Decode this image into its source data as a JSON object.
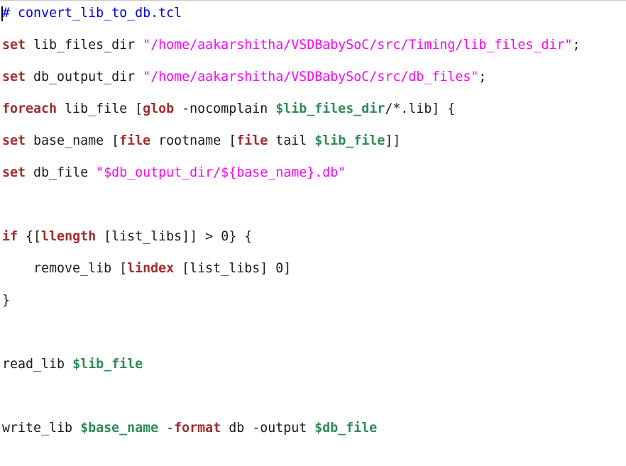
{
  "editor": {
    "colors": {
      "keyword": "#a52a2a",
      "variable": "#2e8b57",
      "string": "#ff00ff",
      "comment": "#0000ee",
      "text": "#1a1a1a",
      "background": "#ffffff"
    },
    "lines": {
      "l1": {
        "comment": "# convert_lib_to_db.tcl"
      },
      "l2": {
        "kw": "set",
        "text": " lib_files_dir ",
        "str": "\"/home/aakarshitha/VSDBabySoC/src/Timing/lib_files_dir\"",
        "tail": ";"
      },
      "l3": {
        "kw": "set",
        "text": " db_output_dir ",
        "str": "\"/home/aakarshitha/VSDBabySoC/src/db_files\"",
        "tail": ";"
      },
      "l4": {
        "kw": "foreach",
        "t1": " lib_file [",
        "kw2": "glob",
        "t2": " -nocomplain ",
        "var": "$lib_files_dir",
        "t3": "/*.lib] {"
      },
      "l5": {
        "kw": "set",
        "t1": " base_name [",
        "kw2": "file",
        "t2": " rootname [",
        "kw3": "file",
        "t3": " tail ",
        "var": "$lib_file",
        "t4": "]]"
      },
      "l6": {
        "kw": "set",
        "text": " db_file ",
        "str": "\"$db_output_dir/${base_name}.db\""
      },
      "l7": {
        "kw": "if",
        "t1": " {[",
        "kw2": "llength",
        "t2": " [list_libs]] > 0} {"
      },
      "l8": {
        "t1": "    remove_lib [",
        "kw": "lindex",
        "t2": " [list_libs] 0]"
      },
      "l9": {
        "text": "}"
      },
      "l10": {
        "t1": "read_lib ",
        "var": "$lib_file"
      },
      "l11": {
        "t1": "write_lib ",
        "var": "$base_name",
        "t2": " -",
        "kw": "format",
        "t3": " db -output ",
        "var2": "$db_file"
      }
    }
  }
}
